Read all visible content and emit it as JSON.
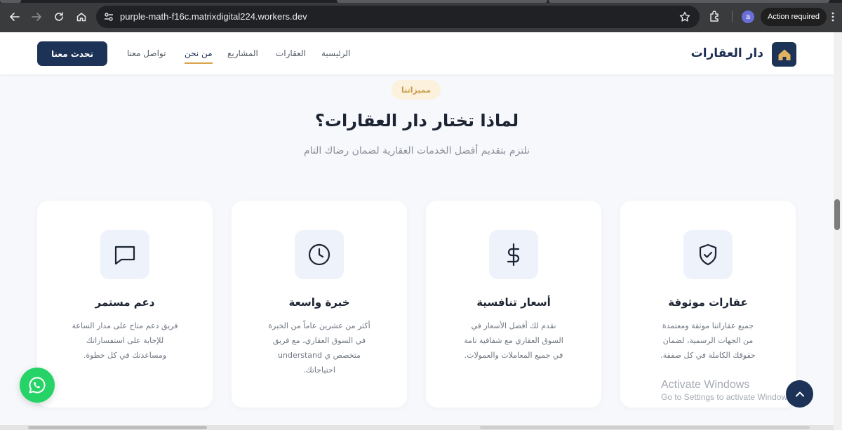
{
  "browser": {
    "url": "purple-math-f16c.matrixdigital224.workers.dev",
    "profile_initial": "a",
    "action_label": "Action required"
  },
  "header": {
    "logo_text": "دار العقارات",
    "nav": {
      "home": "الرئيسية",
      "properties": "العقارات",
      "projects": "المشاريع",
      "about": "من نحن",
      "contact": "تواصل معنا"
    },
    "cta_label": "تحدث معنا"
  },
  "section": {
    "badge": "مميزاتنا",
    "title": "لماذا تختار دار العقارات؟",
    "subtitle": "نلتزم بتقديم أفضل الخدمات العقارية لضمان رضاك التام"
  },
  "cards": [
    {
      "icon": "shield-check-icon",
      "title": "عقارات موثوقة",
      "lines": [
        "جميع عقاراتنا موثقة ومعتمدة",
        "من الجهات الرسمية، لضمان",
        "حقوقك الكاملة في كل صفقة."
      ]
    },
    {
      "icon": "dollar-icon",
      "title": "أسعار تنافسية",
      "lines": [
        "نقدم لك أفضل الأسعار في",
        "السوق العقاري مع شفافية تامة",
        "في جميع المعاملات والعمولات."
      ]
    },
    {
      "icon": "clock-icon",
      "title": "خبرة واسعة",
      "lines": [
        "أكثر من عشرين عاماً من الخبرة",
        "في السوق العقاري، مع فريق",
        "متخصص ي understand",
        "احتياجاتك."
      ]
    },
    {
      "icon": "chat-icon",
      "title": "دعم مستمر",
      "lines": [
        "فريق دعم متاح على مدار الساعة",
        "للإجابة على استفساراتك",
        "ومساعدتك في كل خطوة."
      ]
    }
  ],
  "watermark": {
    "line1": "Activate Windows",
    "line2": "Go to Settings to activate Windows."
  },
  "colors": {
    "navy": "#1c3257",
    "gold": "#d8a24a",
    "whatsapp": "#25d366"
  }
}
